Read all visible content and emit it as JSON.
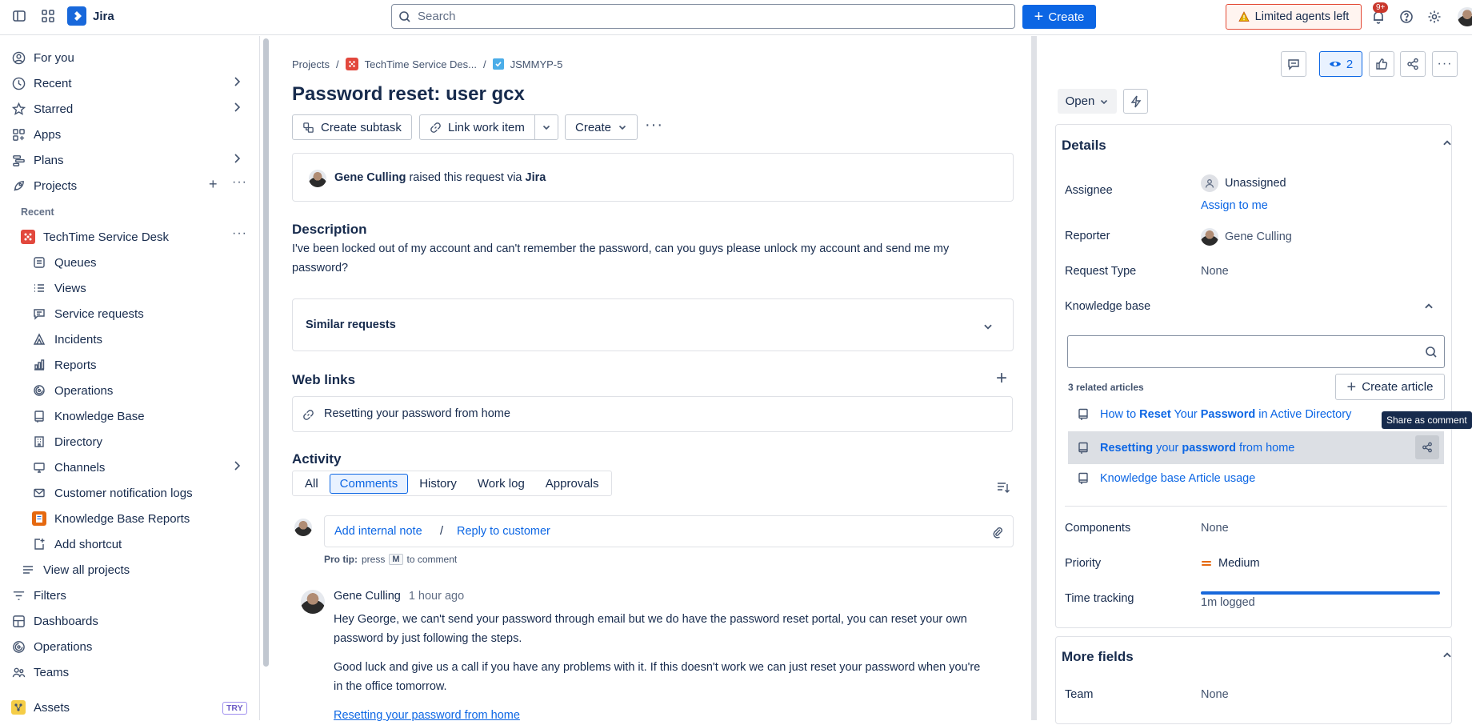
{
  "topbar": {
    "app_name": "Jira",
    "search_placeholder": "Search",
    "create_label": "Create",
    "limited_label": "Limited agents left",
    "notif_badge": "9+"
  },
  "sidebar": {
    "for_you": "For you",
    "recent": "Recent",
    "starred": "Starred",
    "apps": "Apps",
    "plans": "Plans",
    "projects": "Projects",
    "recent_header": "Recent",
    "project_name": "TechTime Service Desk",
    "sub": {
      "queues": "Queues",
      "views": "Views",
      "service_requests": "Service requests",
      "incidents": "Incidents",
      "reports": "Reports",
      "operations": "Operations",
      "knowledge_base": "Knowledge Base",
      "directory": "Directory",
      "channels": "Channels",
      "customer_notification_logs": "Customer notification logs",
      "knowledge_base_reports": "Knowledge Base Reports",
      "add_shortcut": "Add shortcut"
    },
    "view_all_projects": "View all projects",
    "filters": "Filters",
    "dashboards": "Dashboards",
    "operations": "Operations",
    "teams": "Teams",
    "assets": "Assets",
    "assets_badge": "TRY"
  },
  "issue": {
    "crumb_projects": "Projects",
    "crumb_project": "TechTime Service Des...",
    "crumb_key": "JSMMYP-5",
    "title": "Password reset: user gcx",
    "create_subtask": "Create subtask",
    "link_work_item": "Link work item",
    "create": "Create",
    "raiser_name": "Gene Culling",
    "raised_text": "raised this request via",
    "channel": "Jira",
    "description_heading": "Description",
    "description_line1": "I've been locked out of my account and can't remember the password, can you guys please unlock my account and send me my",
    "description_line2": "password?",
    "similar_requests": "Similar requests",
    "web_links_heading": "Web links",
    "web_link": "Resetting your password from home",
    "activity_heading": "Activity",
    "tabs": [
      "All",
      "Comments",
      "History",
      "Work log",
      "Approvals"
    ],
    "add_internal_note": "Add internal note",
    "slash": "/",
    "reply_to_customer": "Reply to customer",
    "pro_tip_bold": "Pro tip:",
    "pro_tip_press": "press",
    "pro_tip_key": "M",
    "pro_tip_rest": "to comment",
    "comment_author": "Gene Culling",
    "comment_time": "1 hour ago",
    "comment_p1_l1": "Hey George, we can't send your password through email but we do have the password reset portal, you can reset your own",
    "comment_p1_l2": "password by just following the steps.",
    "comment_p2_l1": "Good luck and give us a call if you have any problems with it. If this doesn't work we can just reset your password when you're",
    "comment_p2_l2": "in the office tomorrow.",
    "comment_link": "Resetting your password from home"
  },
  "right": {
    "watch_count": "2",
    "status": "Open",
    "details_heading": "Details",
    "assignee_label": "Assignee",
    "assignee_value": "Unassigned",
    "assign_to_me": "Assign to me",
    "reporter_label": "Reporter",
    "reporter_value": "Gene Culling",
    "request_type_label": "Request Type",
    "request_type_value": "None",
    "kb_label": "Knowledge base",
    "related_count": "3 related articles",
    "create_article": "Create article",
    "articles": [
      {
        "pre": "How to ",
        "b1": "Reset",
        "mid": " Your ",
        "b2": "Password",
        "post": " in Active Directory"
      },
      {
        "pre": "",
        "b1": "Resetting",
        "mid": " your ",
        "b2": "password",
        "post": " from home"
      },
      {
        "pre": "Knowledge base Article usage",
        "b1": "",
        "mid": "",
        "b2": "",
        "post": ""
      }
    ],
    "tooltip": "Share as comment",
    "components_label": "Components",
    "components_value": "None",
    "priority_label": "Priority",
    "priority_value": "Medium",
    "time_tracking_label": "Time tracking",
    "time_logged": "1m logged",
    "time_tracking_fill": 1.0,
    "more_fields_heading": "More fields",
    "team_label": "Team",
    "team_value": "None"
  }
}
